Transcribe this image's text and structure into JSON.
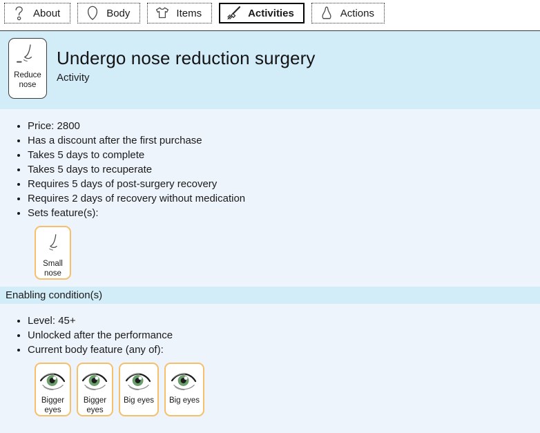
{
  "tabs": [
    {
      "id": "about",
      "label": "About",
      "icon": "question-mark-icon",
      "selected": false
    },
    {
      "id": "body",
      "label": "Body",
      "icon": "head-outline-icon",
      "selected": false
    },
    {
      "id": "items",
      "label": "Items",
      "icon": "tshirt-icon",
      "selected": false
    },
    {
      "id": "activities",
      "label": "Activities",
      "icon": "syringe-icon",
      "selected": true
    },
    {
      "id": "actions",
      "label": "Actions",
      "icon": "bell-jar-icon",
      "selected": false
    }
  ],
  "header": {
    "title": "Undergo nose reduction surgery",
    "subtitle": "Activity",
    "icon_card": {
      "caption_line1": "Reduce",
      "caption_line2": "nose",
      "icon": "nose-profile-icon"
    }
  },
  "details": {
    "facts": [
      "Price: 2800",
      "Has a discount after the first purchase",
      "Takes 5 days to complete",
      "Takes 5 days to recuperate",
      "Requires 5 days of post-surgery recovery",
      "Requires 2 days of recovery without medication",
      "Sets feature(s):"
    ],
    "set_features": [
      {
        "caption_line1": "Small",
        "caption_line2": "nose",
        "icon": "nose-profile-icon",
        "wide": false
      }
    ]
  },
  "enabling": {
    "section_title": "Enabling condition(s)",
    "conditions": [
      "Level: 45+",
      "Unlocked after the performance",
      "Current body feature (any of):"
    ],
    "body_features": [
      {
        "caption_line1": "Bigger",
        "caption_line2": "eyes",
        "icon": "eye-icon",
        "wide": false
      },
      {
        "caption_line1": "Bigger",
        "caption_line2": "eyes",
        "icon": "eye-icon",
        "wide": false
      },
      {
        "caption_line1": "Big eyes",
        "caption_line2": "",
        "icon": "eye-icon",
        "wide": true
      },
      {
        "caption_line1": "Big eyes",
        "caption_line2": "",
        "icon": "eye-icon",
        "wide": true
      }
    ]
  },
  "colors": {
    "band": "#d2ecf8",
    "page_bg": "#eef4fc",
    "feature_border": "#f5bf6b",
    "iris_green": "#6a9e6a"
  }
}
